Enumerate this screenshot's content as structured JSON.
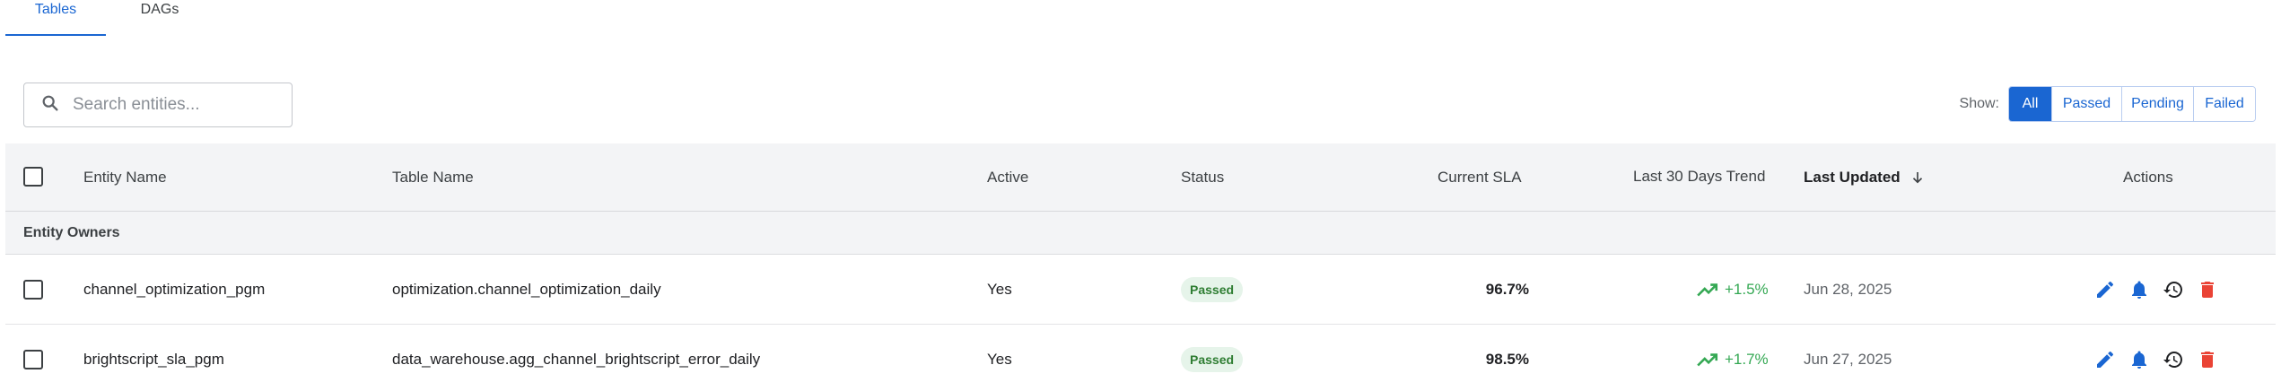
{
  "tabs": [
    {
      "label": "Tables",
      "active": true
    },
    {
      "label": "DAGs",
      "active": false
    }
  ],
  "search": {
    "placeholder": "Search entities..."
  },
  "filter": {
    "label": "Show:",
    "options": [
      "All",
      "Passed",
      "Pending",
      "Failed"
    ],
    "selected": "All"
  },
  "table": {
    "columns": {
      "entity_name": "Entity Name",
      "table_name": "Table Name",
      "active": "Active",
      "status": "Status",
      "current_sla": "Current SLA",
      "trend": "Last 30 Days Trend",
      "last_updated": "Last Updated",
      "actions": "Actions"
    },
    "sort_column": "Last Updated",
    "sort_direction": "descending",
    "group_label": "Entity Owners",
    "rows": [
      {
        "entity_name": "channel_optimization_pgm",
        "table_name": "optimization.channel_optimization_daily",
        "active": "Yes",
        "status": "Passed",
        "current_sla": "96.7%",
        "trend": "+1.5%",
        "last_updated": "Jun 28, 2025"
      },
      {
        "entity_name": "brightscript_sla_pgm",
        "table_name": "data_warehouse.agg_channel_brightscript_error_daily",
        "active": "Yes",
        "status": "Passed",
        "current_sla": "98.5%",
        "trend": "+1.7%",
        "last_updated": "Jun 27, 2025"
      }
    ]
  },
  "colors": {
    "accent": "#1a66d2",
    "passed_badge_bg": "#e6f4ea",
    "passed_badge_text": "#2e7d32",
    "trend_up": "#34a853",
    "delete": "#ea4335"
  },
  "icons": {
    "search": "search-icon",
    "sort": "arrow-down-icon",
    "trend": "trending-up-icon",
    "edit": "pencil-icon",
    "alert": "bell-icon",
    "history": "history-icon",
    "delete": "trash-icon"
  }
}
